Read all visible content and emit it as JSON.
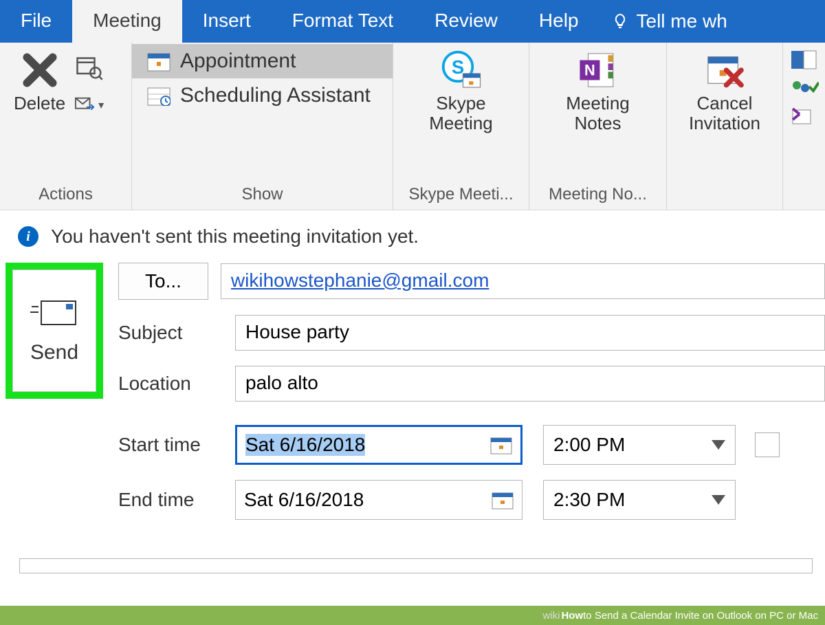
{
  "tabs": {
    "file": "File",
    "meeting": "Meeting",
    "insert": "Insert",
    "format_text": "Format Text",
    "review": "Review",
    "help": "Help",
    "tell_me": "Tell me wh"
  },
  "ribbon": {
    "actions": {
      "delete": "Delete",
      "group": "Actions"
    },
    "show": {
      "appointment": "Appointment",
      "scheduling": "Scheduling Assistant",
      "group": "Show"
    },
    "skype": {
      "line1": "Skype",
      "line2": "Meeting",
      "group": "Skype Meeti..."
    },
    "notes": {
      "line1": "Meeting",
      "line2": "Notes",
      "group": "Meeting No..."
    },
    "cancel": {
      "line1": "Cancel",
      "line2": "Invitation"
    }
  },
  "info": "You haven't sent this meeting invitation yet.",
  "send": "Send",
  "form": {
    "to_label": "To...",
    "to_value": "wikihowstephanie@gmail.com",
    "subject_label": "Subject",
    "subject_value": "House party",
    "location_label": "Location",
    "location_value": "palo alto",
    "start_label": "Start time",
    "start_date": "Sat 6/16/2018",
    "start_time": "2:00 PM",
    "end_label": "End time",
    "end_date": "Sat 6/16/2018",
    "end_time": "2:30 PM"
  },
  "footer": {
    "wiki": "wiki",
    "how": "How",
    "rest": " to Send a Calendar Invite on Outlook on PC or Mac"
  }
}
